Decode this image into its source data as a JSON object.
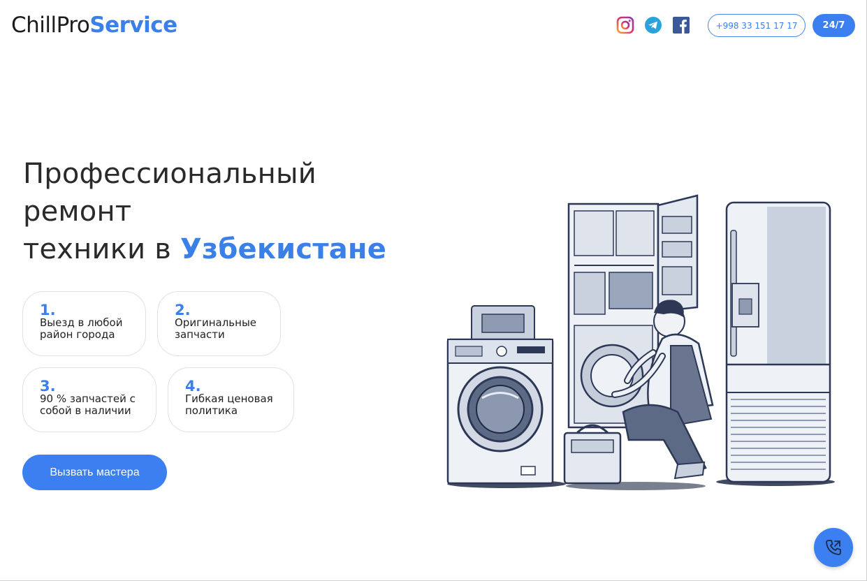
{
  "brand": {
    "name_part1": "ChillPro",
    "name_part2": "Service",
    "accent": "#3b7fe8"
  },
  "header": {
    "social": [
      {
        "name": "instagram-icon"
      },
      {
        "name": "telegram-icon"
      },
      {
        "name": "facebook-icon"
      }
    ],
    "phone": "+998 33 151 17 17",
    "hours": "24/7"
  },
  "hero": {
    "title_line1": "Профессиональный",
    "title_line2": "ремонт",
    "title_line3a": "техники в ",
    "title_line3b": "Узбекистане",
    "features": [
      {
        "num": "1.",
        "text": "Выезд в любой\nрайон города"
      },
      {
        "num": "2.",
        "text": "Оригинальные\nзапчасти"
      },
      {
        "num": "3.",
        "text": "90 % запчастей с\nсобой в наличии"
      },
      {
        "num": "4.",
        "text": "Гибкая ценовая\nполитика"
      }
    ],
    "cta": "Вызвать мастера"
  },
  "illustration": {
    "description_icon": "technician-appliances-illustration"
  },
  "fab": {
    "icon": "phone-call-icon"
  }
}
